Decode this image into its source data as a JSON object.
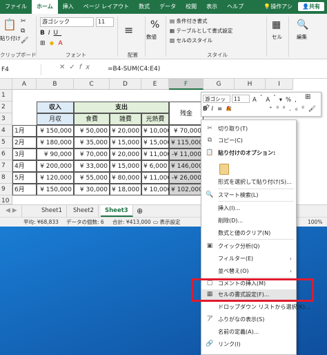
{
  "ribbon": {
    "tabs": [
      "ファイル",
      "ホーム",
      "挿入",
      "ページ レイアウト",
      "数式",
      "データ",
      "校閲",
      "表示",
      "ヘルプ"
    ],
    "tell_me": "操作アシ",
    "share": "共有",
    "clipboard_label": "クリップボード",
    "paste": "貼り付け",
    "font_name": "游ゴシック",
    "font_size": "11",
    "font_label": "フォント",
    "align_label": "配置",
    "number_label": "数値",
    "conditional_format": "条件付き書式",
    "table_format": "テーブルとして書式設定",
    "cell_styles": "セルのスタイル",
    "styles_label": "スタイル",
    "cells_label": "セル",
    "edit_label": "編集"
  },
  "formula_bar": {
    "name_box": "F4",
    "formula": "=B4-SUM(C4:E4)"
  },
  "columns": [
    "A",
    "B",
    "C",
    "D",
    "E",
    "F",
    "G",
    "H",
    "I"
  ],
  "rows": [
    "1",
    "2",
    "3",
    "4",
    "5",
    "6",
    "7",
    "8",
    "9",
    "10"
  ],
  "table": {
    "income_header": "収入",
    "expense_header": "支出",
    "monthly_income": "月収",
    "food": "食費",
    "misc": "雑費",
    "utilities": "光熱費",
    "balance": "残金",
    "months": [
      "1月",
      "2月",
      "3月",
      "4月",
      "5月",
      "6月"
    ],
    "income": [
      "¥ 150,000",
      "¥ 180,000",
      "¥ 90,000",
      "¥ 200,000",
      "¥ 120,000",
      "¥ 150,000"
    ],
    "food_vals": [
      "¥ 50,000",
      "¥ 35,000",
      "¥ 70,000",
      "¥ 33,000",
      "¥ 55,000",
      "¥ 30,000"
    ],
    "misc_vals": [
      "¥ 20,000",
      "¥ 15,000",
      "¥ 20,000",
      "¥ 15,000",
      "¥ 80,000",
      "¥ 18,000"
    ],
    "util_vals": [
      "¥ 10,000",
      "¥ 15,000",
      "¥ 11,000",
      "¥ 6,000",
      "¥ 11,000",
      "¥ 10,000"
    ],
    "balance_vals": [
      "¥ 70,000",
      "¥ 115,000",
      "-¥ 11,000",
      "¥ 146,000",
      "-¥ 26,000",
      "¥ 102,000"
    ]
  },
  "sheets": [
    "Sheet1",
    "Sheet2",
    "Sheet3"
  ],
  "status": {
    "average": "平均: ¥68,833",
    "count": "データの個数: 6",
    "sum": "合計: ¥413,000",
    "display_settings": "表示設定",
    "zoom": "100%"
  },
  "mini_toolbar": {
    "font": "游ゴシック",
    "size": "11"
  },
  "context_menu": {
    "cut": "切り取り(T)",
    "copy": "コピー(C)",
    "paste_options": "貼り付けのオプション:",
    "paste_special": "形式を選択して貼り付け(S)...",
    "smart_lookup": "スマート検索(L)",
    "insert": "挿入(I)...",
    "delete": "削除(D)...",
    "clear": "数式と値のクリア(N)",
    "quick_analysis": "クイック分析(Q)",
    "filter": "フィルター(E)",
    "sort": "並べ替え(O)",
    "insert_comment": "コメントの挿入(M)",
    "format_cells": "セルの書式設定(F)...",
    "dropdown": "ドロップダウン リストから選択(K)...",
    "furigana": "ふりがなの表示(S)",
    "define_name": "名前の定義(A)...",
    "link": "リンク(I)"
  }
}
